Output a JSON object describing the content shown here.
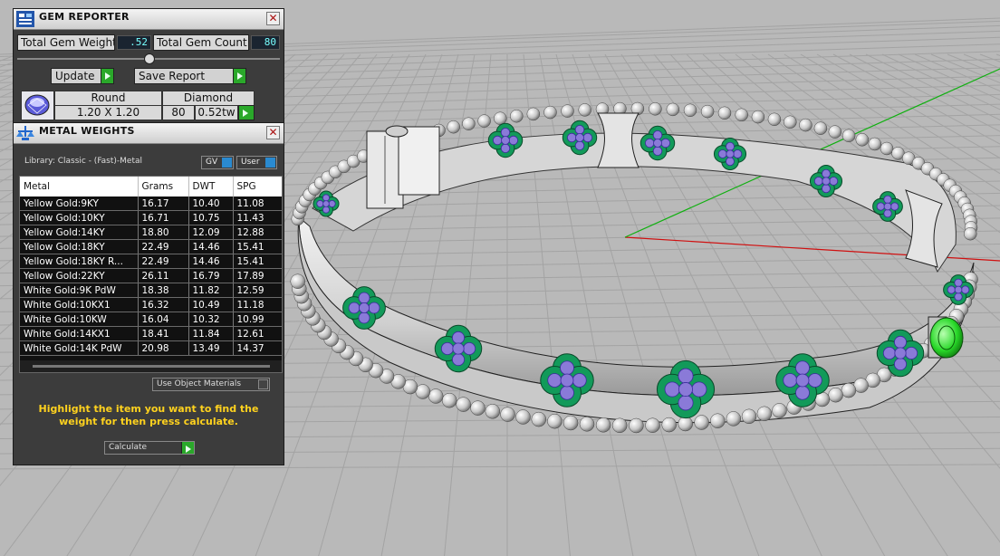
{
  "gem_reporter": {
    "title": "GEM REPORTER",
    "total_gem_weight_label": "Total Gem Weight",
    "total_gem_weight_value": ".52",
    "total_gem_count_label": "Total Gem Count",
    "total_gem_count_value": "80",
    "update_label": "Update",
    "save_report_label": "Save Report",
    "gem_row": {
      "shape": "Round",
      "type": "Diamond",
      "size": "1.20 X 1.20",
      "count": "80",
      "weight": "0.52tw"
    }
  },
  "metal_weights": {
    "title": "METAL WEIGHTS",
    "library_label": "Library: Classic - (Fast)-Metal",
    "gv_label": "GV",
    "user_label": "User",
    "columns": [
      "Metal",
      "Grams",
      "DWT",
      "SPG"
    ],
    "rows": [
      [
        "Yellow Gold:9KY",
        "16.17",
        "10.40",
        "11.08"
      ],
      [
        "Yellow Gold:10KY",
        "16.71",
        "10.75",
        "11.43"
      ],
      [
        "Yellow Gold:14KY",
        "18.80",
        "12.09",
        "12.88"
      ],
      [
        "Yellow Gold:18KY",
        "22.49",
        "14.46",
        "15.41"
      ],
      [
        "Yellow Gold:18KY R...",
        "22.49",
        "14.46",
        "15.41"
      ],
      [
        "Yellow Gold:22KY",
        "26.11",
        "16.79",
        "17.89"
      ],
      [
        "White Gold:9K PdW",
        "18.38",
        "11.82",
        "12.59"
      ],
      [
        "White Gold:10KX1",
        "16.32",
        "10.49",
        "11.18"
      ],
      [
        "White Gold:10KW",
        "16.04",
        "10.32",
        "10.99"
      ],
      [
        "White Gold:14KX1",
        "18.41",
        "11.84",
        "12.61"
      ],
      [
        "White Gold:14K PdW",
        "20.98",
        "13.49",
        "14.37"
      ]
    ],
    "use_object_materials_label": "Use Object Materials",
    "instruction": "Highlight the item you want to find the weight for then press calculate.",
    "calculate_label": "Calculate"
  },
  "colors": {
    "panel_bg": "#3c3c3c",
    "value_text": "#77ffff",
    "play_green": "#2aa82a",
    "instruction_yellow": "#ffd21e",
    "viewport_bg": "#b9b9b9",
    "grid_red_axis": "#d01010",
    "grid_green_axis": "#10b010",
    "ring_metal": "#d8d8d8",
    "gem_green": "#129a5a",
    "gem_purple": "#8a7ad8"
  },
  "icons": {
    "gem_reporter": "gem-reporter-icon",
    "metal_weights": "metal-weights-icon",
    "gem_shape": "round-diamond-gem-icon",
    "close": "close-icon",
    "play": "play-arrow-icon",
    "slider": "slider-handle-icon"
  }
}
